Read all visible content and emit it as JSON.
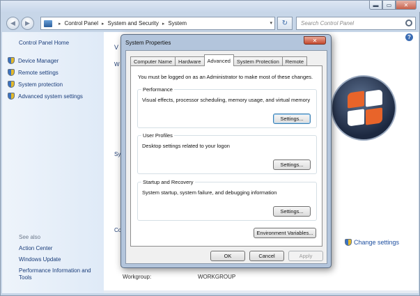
{
  "window": {
    "caption_minimize": "▬",
    "caption_maximize": "▭",
    "caption_close": "✕"
  },
  "nav": {
    "back": "◀",
    "forward": "▶",
    "breadcrumb": [
      "Control Panel",
      "System and Security",
      "System"
    ],
    "search_placeholder": "Search Control Panel",
    "refresh": "↻"
  },
  "sidebar": {
    "home": "Control Panel Home",
    "items": [
      {
        "label": "Device Manager"
      },
      {
        "label": "Remote settings"
      },
      {
        "label": "System protection"
      },
      {
        "label": "Advanced system settings"
      }
    ],
    "see_also": "See also",
    "links": [
      {
        "label": "Action Center"
      },
      {
        "label": "Windows Update"
      },
      {
        "label": "Performance Information and Tools"
      }
    ]
  },
  "main": {
    "help": "?",
    "fragments": [
      "V",
      "W",
      "Sy",
      "Co"
    ],
    "change_settings": "Change settings",
    "workgroup_label": "Workgroup:",
    "workgroup_value": "WORKGROUP"
  },
  "dialog": {
    "title": "System Properties",
    "close": "✕",
    "tabs": [
      "Computer Name",
      "Hardware",
      "Advanced",
      "System Protection",
      "Remote"
    ],
    "active_tab": "Advanced",
    "admin_note": "You must be logged on as an Administrator to make most of these changes.",
    "groups": {
      "performance": {
        "title": "Performance",
        "description": "Visual effects, processor scheduling, memory usage, and virtual memory",
        "button": "Settings..."
      },
      "user_profiles": {
        "title": "User Profiles",
        "description": "Desktop settings related to your logon",
        "button": "Settings..."
      },
      "startup_recovery": {
        "title": "Startup and Recovery",
        "description": "System startup, system failure, and debugging information",
        "button": "Settings..."
      }
    },
    "env_button": "Environment Variables...",
    "ok": "OK",
    "cancel": "Cancel",
    "apply": "Apply"
  }
}
